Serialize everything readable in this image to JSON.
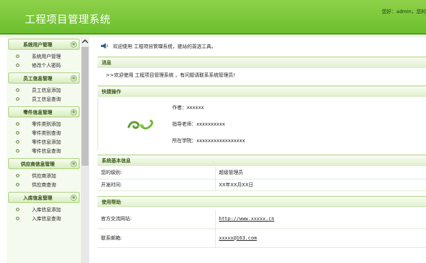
{
  "header": {
    "title": "工程项目管理系统",
    "welcome": "您好：admin，您的"
  },
  "sidebar": {
    "sections": [
      {
        "label": "系统用户管理",
        "items": [
          "系统用户管理",
          "修改个人密码"
        ]
      },
      {
        "label": "员工信息管理",
        "items": [
          "员工信息添加",
          "员工信息查询"
        ]
      },
      {
        "label": "零件信息管理",
        "items": [
          "零件类别添加",
          "零件类别查询",
          "零件信息添加",
          "零件信息查询"
        ]
      },
      {
        "label": "供应商信息管理",
        "items": [
          "供应商添加",
          "供应商查询"
        ]
      },
      {
        "label": "入库信息管理",
        "items": [
          "入库信息添加",
          "入库信息查询"
        ]
      }
    ],
    "collapse_glyph": "⊗"
  },
  "main": {
    "welcome_text": "欢迎使用 工程项目管理系统，建站的首选工具。",
    "message": {
      "title": "消息",
      "text": ">>欢迎使用 工程项目管理系统 ，有问题请联系系统管理员!"
    },
    "quick": {
      "title": "快捷操作",
      "author": "作者：xxxxxx",
      "teacher": "指导老师：xxxxxxxxxx",
      "school": "所在学院：xxxxxxxxxxxxxxxxx"
    },
    "basic": {
      "title": "系统基本信息",
      "rows": [
        {
          "key": "您的级别:",
          "value": "超级管理员"
        },
        {
          "key": "开发时间:",
          "value": "XX年XX月XX日"
        }
      ]
    },
    "help": {
      "title": "使用帮助",
      "rows": [
        {
          "key": "官方交流网站:",
          "value": "http://www.xxxxx.cn"
        },
        {
          "key": "联系邮箱:",
          "value": "xxxxx@163.com"
        }
      ]
    }
  },
  "colors": {
    "header_green": "#7cc63a",
    "accent_dark": "#3d5d1b"
  },
  "icons": {
    "scroll_up": "scroll-up-arrow-icon",
    "speaker": "speaker-icon",
    "logo": "swirl-logo-icon"
  }
}
